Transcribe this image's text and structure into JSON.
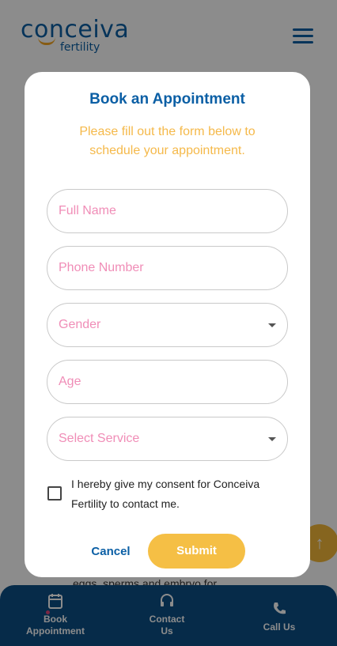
{
  "brand": {
    "logo_main": "conceiva",
    "logo_sub": "fertility"
  },
  "background": {
    "partial_text": "eggs, sperms and embryo for"
  },
  "modal": {
    "title": "Book an Appointment",
    "subtitle": "Please fill out the form below to schedule your appointment.",
    "fields": {
      "full_name": {
        "placeholder": "Full Name",
        "value": ""
      },
      "phone": {
        "placeholder": "Phone Number",
        "value": ""
      },
      "gender": {
        "placeholder": "Gender",
        "value": ""
      },
      "age": {
        "placeholder": "Age",
        "value": ""
      },
      "service": {
        "placeholder": "Select Service",
        "value": ""
      }
    },
    "consent": {
      "checked": false,
      "text": "I hereby give my consent for Conceiva Fertility to contact me."
    },
    "cancel_label": "Cancel",
    "submit_label": "Submit"
  },
  "bottom_nav": {
    "items": [
      {
        "label_line1": "Book",
        "label_line2": "Appointment",
        "icon": "calendar-icon"
      },
      {
        "label_line1": "Contact",
        "label_line2": "Us",
        "icon": "headset-icon"
      },
      {
        "label_line1": "Call Us",
        "label_line2": "",
        "icon": "phone-icon"
      }
    ]
  },
  "colors": {
    "primary": "#0b5fa5",
    "accent": "#f5bf45",
    "placeholder": "#f08db7",
    "nav_bg": "#0b4f86"
  }
}
